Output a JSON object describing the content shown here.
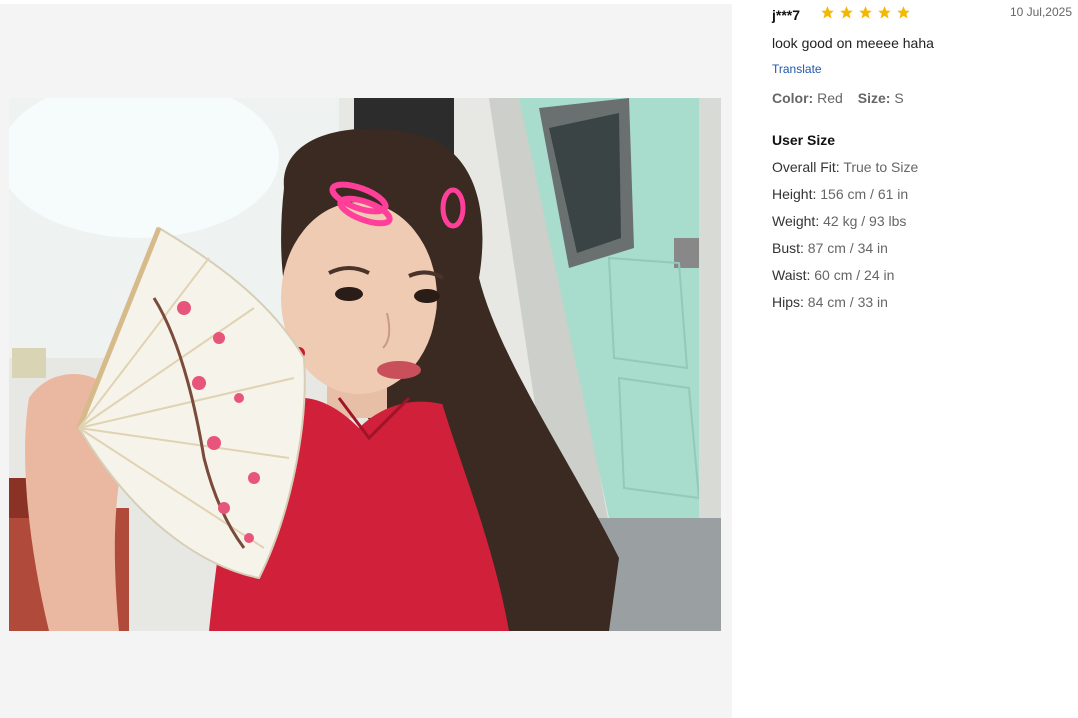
{
  "review": {
    "username": "j***7",
    "rating": 5,
    "rating_max": 5,
    "date": "10 Jul,2025",
    "comment": "look good on meeee haha",
    "translate_label": "Translate",
    "attributes": [
      {
        "key": "Color:",
        "value": "Red"
      },
      {
        "key": "Size:",
        "value": "S"
      }
    ],
    "user_size": {
      "title": "User Size",
      "rows": [
        {
          "key": "Overall Fit:",
          "value": "True to Size"
        },
        {
          "key": "Height:",
          "value": "156 cm / 61 in"
        },
        {
          "key": "Weight:",
          "value": "42 kg / 93 lbs"
        },
        {
          "key": "Bust:",
          "value": "87 cm / 34 in"
        },
        {
          "key": "Waist:",
          "value": "60 cm / 24 in"
        },
        {
          "key": "Hips:",
          "value": "84 cm / 33 in"
        }
      ]
    }
  },
  "colors": {
    "star": "#f5b800",
    "link": "#2158a8",
    "dress": "#d0203a",
    "door": "#a8dccd",
    "hair_clip": "#ff3f9a"
  }
}
